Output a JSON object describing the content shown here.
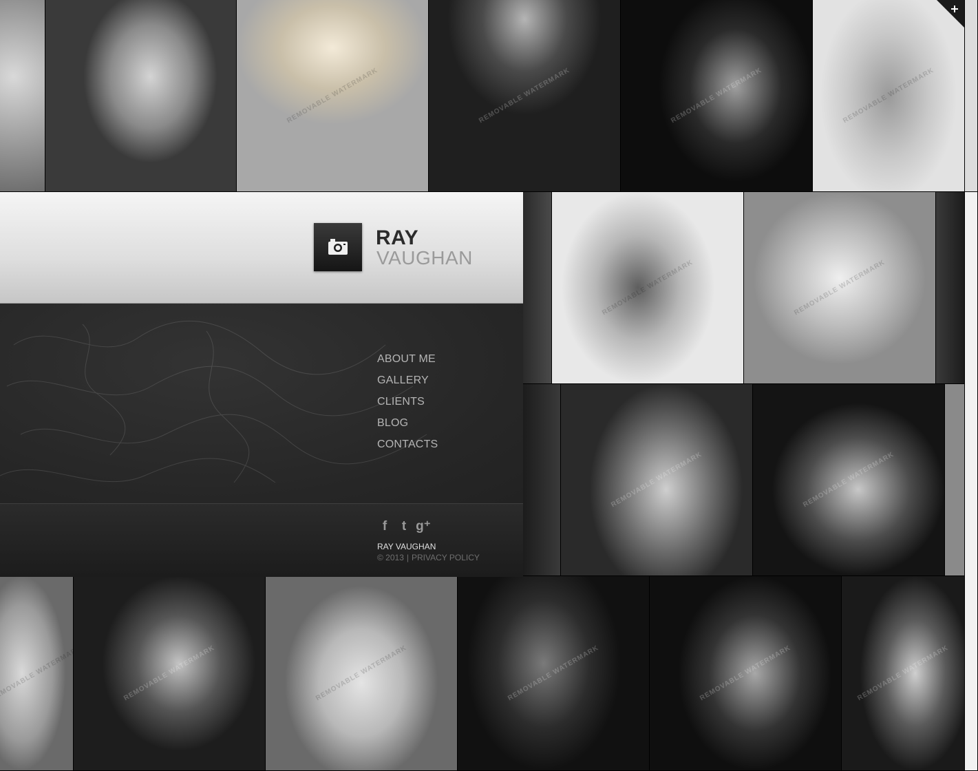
{
  "brand": {
    "first": "RAY",
    "last": "VAUGHAN",
    "logo_icon": "camera-icon"
  },
  "nav": [
    {
      "label": "ABOUT ME"
    },
    {
      "label": "GALLERY"
    },
    {
      "label": "CLIENTS"
    },
    {
      "label": "BLOG"
    },
    {
      "label": "CONTACTS"
    }
  ],
  "social": [
    {
      "icon": "facebook-icon",
      "glyph": "f"
    },
    {
      "icon": "twitter-icon",
      "glyph": "t"
    },
    {
      "icon": "google-plus-icon",
      "glyph": "g⁺"
    }
  ],
  "footer": {
    "name": "RAY VAUGHAN",
    "year": "© 2013",
    "separator": "|",
    "privacy": "PRIVACY POLICY"
  },
  "gallery": {
    "watermark": "REMOVABLE WATERMARK",
    "corner_icon": "plus-icon"
  },
  "colors": {
    "panel_light": "#e6e6e6",
    "panel_dark": "#262626",
    "logo_box": "#1f1f1f",
    "nav_text": "#b5b5b5"
  }
}
